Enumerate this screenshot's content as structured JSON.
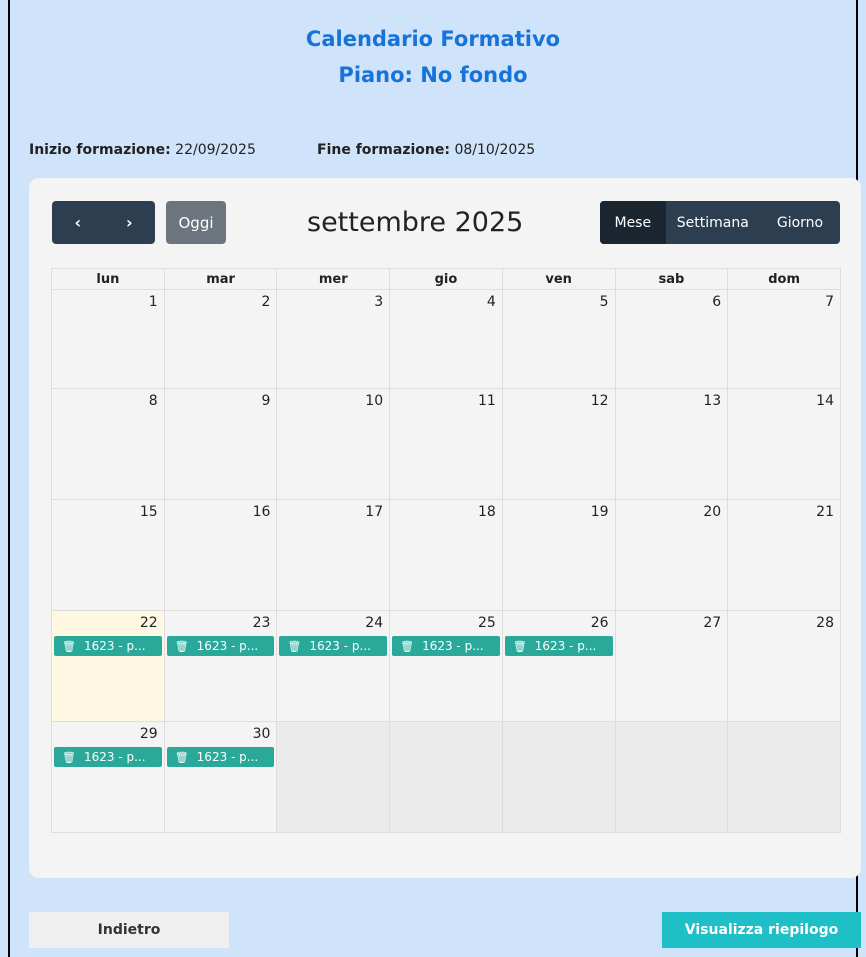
{
  "header": {
    "title": "Calendario Formativo",
    "subtitle": "Piano: No fondo"
  },
  "dates": {
    "start_label": "Inizio formazione:",
    "start_value": "22/09/2025",
    "end_label": "Fine formazione:",
    "end_value": "08/10/2025"
  },
  "toolbar": {
    "prev": "‹",
    "next": "›",
    "today": "Oggi",
    "month_title": "settembre 2025",
    "views": [
      "Mese",
      "Settimana",
      "Giorno"
    ],
    "active_view": "Mese"
  },
  "weekdays": [
    "lun",
    "mar",
    "mer",
    "gio",
    "ven",
    "sab",
    "dom"
  ],
  "weeks": [
    [
      "1",
      "2",
      "3",
      "4",
      "5",
      "6",
      "7"
    ],
    [
      "8",
      "9",
      "10",
      "11",
      "12",
      "13",
      "14"
    ],
    [
      "15",
      "16",
      "17",
      "18",
      "19",
      "20",
      "21"
    ],
    [
      "22",
      "23",
      "24",
      "25",
      "26",
      "27",
      "28"
    ],
    [
      "29",
      "30",
      "",
      "",
      "",
      "",
      ""
    ]
  ],
  "event_label": "1623 - p...",
  "event_days": [
    "22",
    "23",
    "24",
    "25",
    "26",
    "29",
    "30"
  ],
  "today": "22",
  "colors": {
    "event": "#2aa89a",
    "nav": "#2c3e50",
    "accent": "#1773d6",
    "summary_button": "#1fbfc8"
  },
  "footer": {
    "back": "Indietro",
    "summary": "Visualizza riepilogo"
  }
}
